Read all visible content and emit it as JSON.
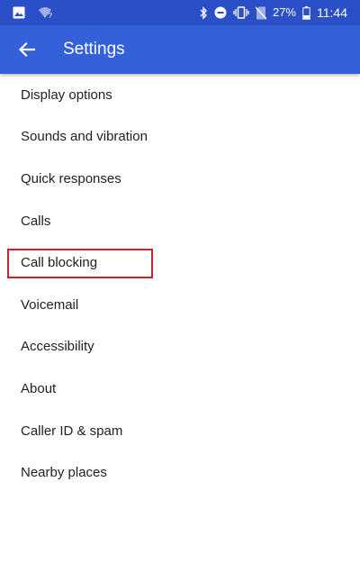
{
  "status_bar": {
    "icons_left": [
      "image-icon",
      "wifi-question-icon"
    ],
    "icons_right": [
      "bluetooth-icon",
      "do-not-disturb-icon",
      "vibrate-icon",
      "no-sim-icon"
    ],
    "battery_percent": "27%",
    "time": "11:44",
    "bar_color": "#2a4fc6"
  },
  "app_bar": {
    "title": "Settings",
    "back_icon": "arrow-back-icon",
    "color": "#3460d8"
  },
  "settings": {
    "items": [
      {
        "label": "Display options"
      },
      {
        "label": "Sounds and vibration"
      },
      {
        "label": "Quick responses"
      },
      {
        "label": "Calls"
      },
      {
        "label": "Call blocking",
        "highlighted": true
      },
      {
        "label": "Voicemail"
      },
      {
        "label": "Accessibility"
      },
      {
        "label": "About"
      },
      {
        "label": "Caller ID & spam"
      },
      {
        "label": "Nearby places"
      }
    ]
  },
  "highlight_color": "#d0202a"
}
